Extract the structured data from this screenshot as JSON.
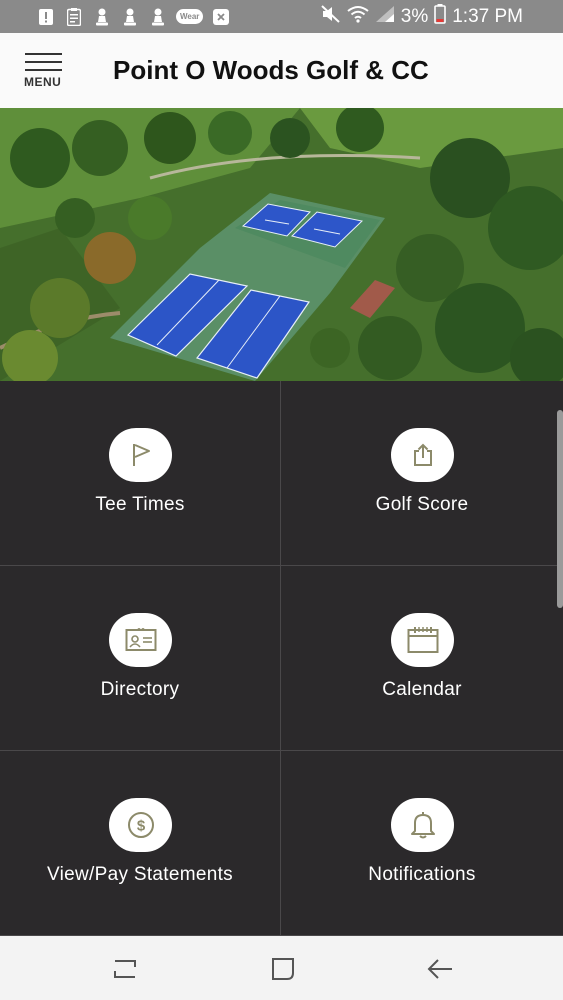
{
  "status_bar": {
    "left_icons": [
      "alert-icon",
      "clipboard-icon",
      "chess-pawn-icon",
      "chess-pawn-icon",
      "chess-pawn-icon",
      "wear-icon",
      "close-box-icon"
    ],
    "wear_label": "Wear",
    "right_icons": [
      "mute-icon",
      "wifi-icon",
      "signal-icon",
      "battery-icon"
    ],
    "battery": "3%",
    "time": "1:37 PM"
  },
  "app_bar": {
    "menu_label": "MENU",
    "title": "Point O Woods Golf & CC"
  },
  "tiles": [
    {
      "label": "Tee Times",
      "icon": "flag-icon"
    },
    {
      "label": "Golf Score",
      "icon": "share-upload-icon"
    },
    {
      "label": "Directory",
      "icon": "id-card-icon"
    },
    {
      "label": "Calendar",
      "icon": "calendar-icon"
    },
    {
      "label": "View/Pay Statements",
      "icon": "dollar-icon"
    },
    {
      "label": "Notifications",
      "icon": "bell-icon"
    }
  ],
  "nav_bar": {
    "buttons": [
      "recent-apps-icon",
      "home-icon",
      "back-icon"
    ]
  },
  "colors": {
    "status_bar": "#8a8a8a",
    "app_bar": "#fafafa",
    "tile_background": "#2b292b",
    "icon_accent": "#8c8a6a",
    "nav_bar": "#f3f3f3"
  }
}
